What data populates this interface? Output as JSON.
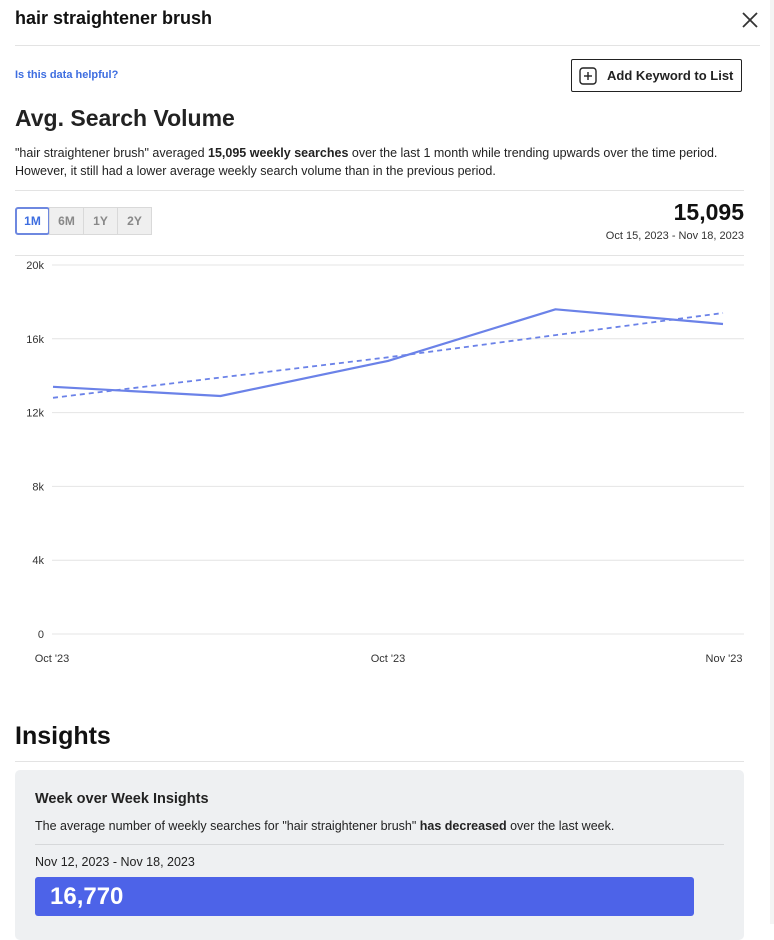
{
  "header": {
    "title": "hair straightener brush"
  },
  "actions": {
    "helpful_link": "Is this data helpful?",
    "add_keyword": "Add Keyword to List"
  },
  "volume": {
    "title": "Avg. Search Volume",
    "summary": {
      "prefix": "\"hair straightener brush\" averaged ",
      "bold": "15,095 weekly searches",
      "suffix": " over the last 1 month while trending upwards over the time period. However, it still had a lower average weekly search volume than in the previous period."
    },
    "range_tabs": [
      "1M",
      "6M",
      "1Y",
      "2Y"
    ],
    "active_tab": "1M",
    "value": "15,095",
    "date_range": "Oct 15, 2023 - Nov 18, 2023"
  },
  "chart_data": {
    "type": "line",
    "y_ticks": [
      "20k",
      "16k",
      "12k",
      "8k",
      "4k",
      "0"
    ],
    "ylim": [
      0,
      20000
    ],
    "x_ticks": [
      "Oct '23",
      "Oct '23",
      "Nov '23"
    ],
    "series": [
      {
        "values": [
          13400,
          12900,
          14800,
          17600,
          16800
        ],
        "style": "solid",
        "color": "#6b82e8"
      },
      {
        "values": [
          12800,
          13900,
          15000,
          16200,
          17400
        ],
        "style": "dashed",
        "color": "#6b82e8"
      }
    ],
    "grid": true
  },
  "insights": {
    "title": "Insights",
    "card_title": "Week over Week Insights",
    "text_prefix": "The average number of weekly searches for \"hair straightener brush\" ",
    "text_bold": "has decreased",
    "text_suffix": " over the last week.",
    "week_range": "Nov 12, 2023 - Nov 18, 2023",
    "week_value": "16,770",
    "bar_color": "#4d63e8"
  }
}
